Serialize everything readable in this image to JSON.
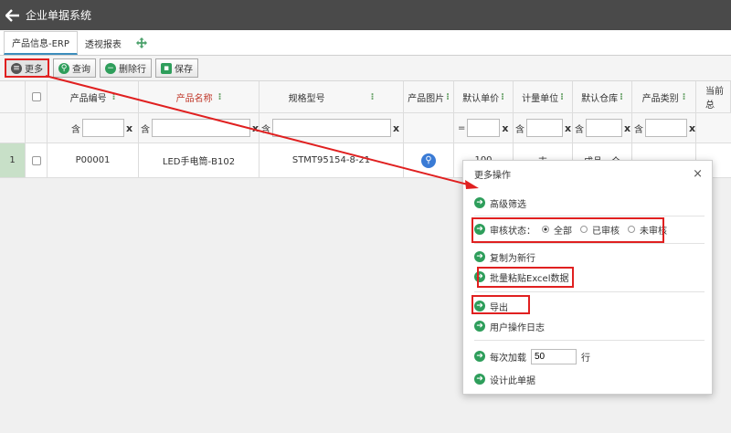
{
  "app": {
    "title": "企业单据系统"
  },
  "tabs": [
    {
      "label": "产品信息-ERP"
    },
    {
      "label": "透视报表"
    }
  ],
  "toolbar": {
    "more": "更多",
    "query": "查询",
    "delete_row": "删除行",
    "save": "保存"
  },
  "grid": {
    "columns": [
      "产品编号",
      "产品名称",
      "规格型号",
      "产品图片",
      "默认单价",
      "计量单位",
      "默认仓库",
      "产品类别",
      "当前总"
    ],
    "filter": {
      "contains": "含",
      "equals": "=",
      "clear": "x"
    },
    "rows": [
      {
        "num": "1",
        "code": "P00001",
        "name": "LED手电筒-B102",
        "spec": "STMT95154-8-21",
        "price": "100",
        "unit": "支",
        "warehouse": "成品一仓",
        "category": ""
      }
    ]
  },
  "dialog": {
    "title": "更多操作",
    "close": "×",
    "items": {
      "advanced_filter": "高级筛选",
      "audit_status": "审核状态：",
      "audit_all": "全部",
      "audit_done": "已审核",
      "audit_pending": "未审核",
      "copy_new": "复制为新行",
      "batch_paste": "批量粘贴Excel数据",
      "export": "导出",
      "user_log": "用户操作日志",
      "load_prefix": "每次加载",
      "load_value": "50",
      "load_suffix": "行",
      "design": "设计此单据"
    }
  },
  "colors": {
    "topbar": "#4a4a4a",
    "accent_green": "#2e9e5b",
    "highlight_red": "#e02020",
    "link_blue": "#3a7bd5"
  }
}
